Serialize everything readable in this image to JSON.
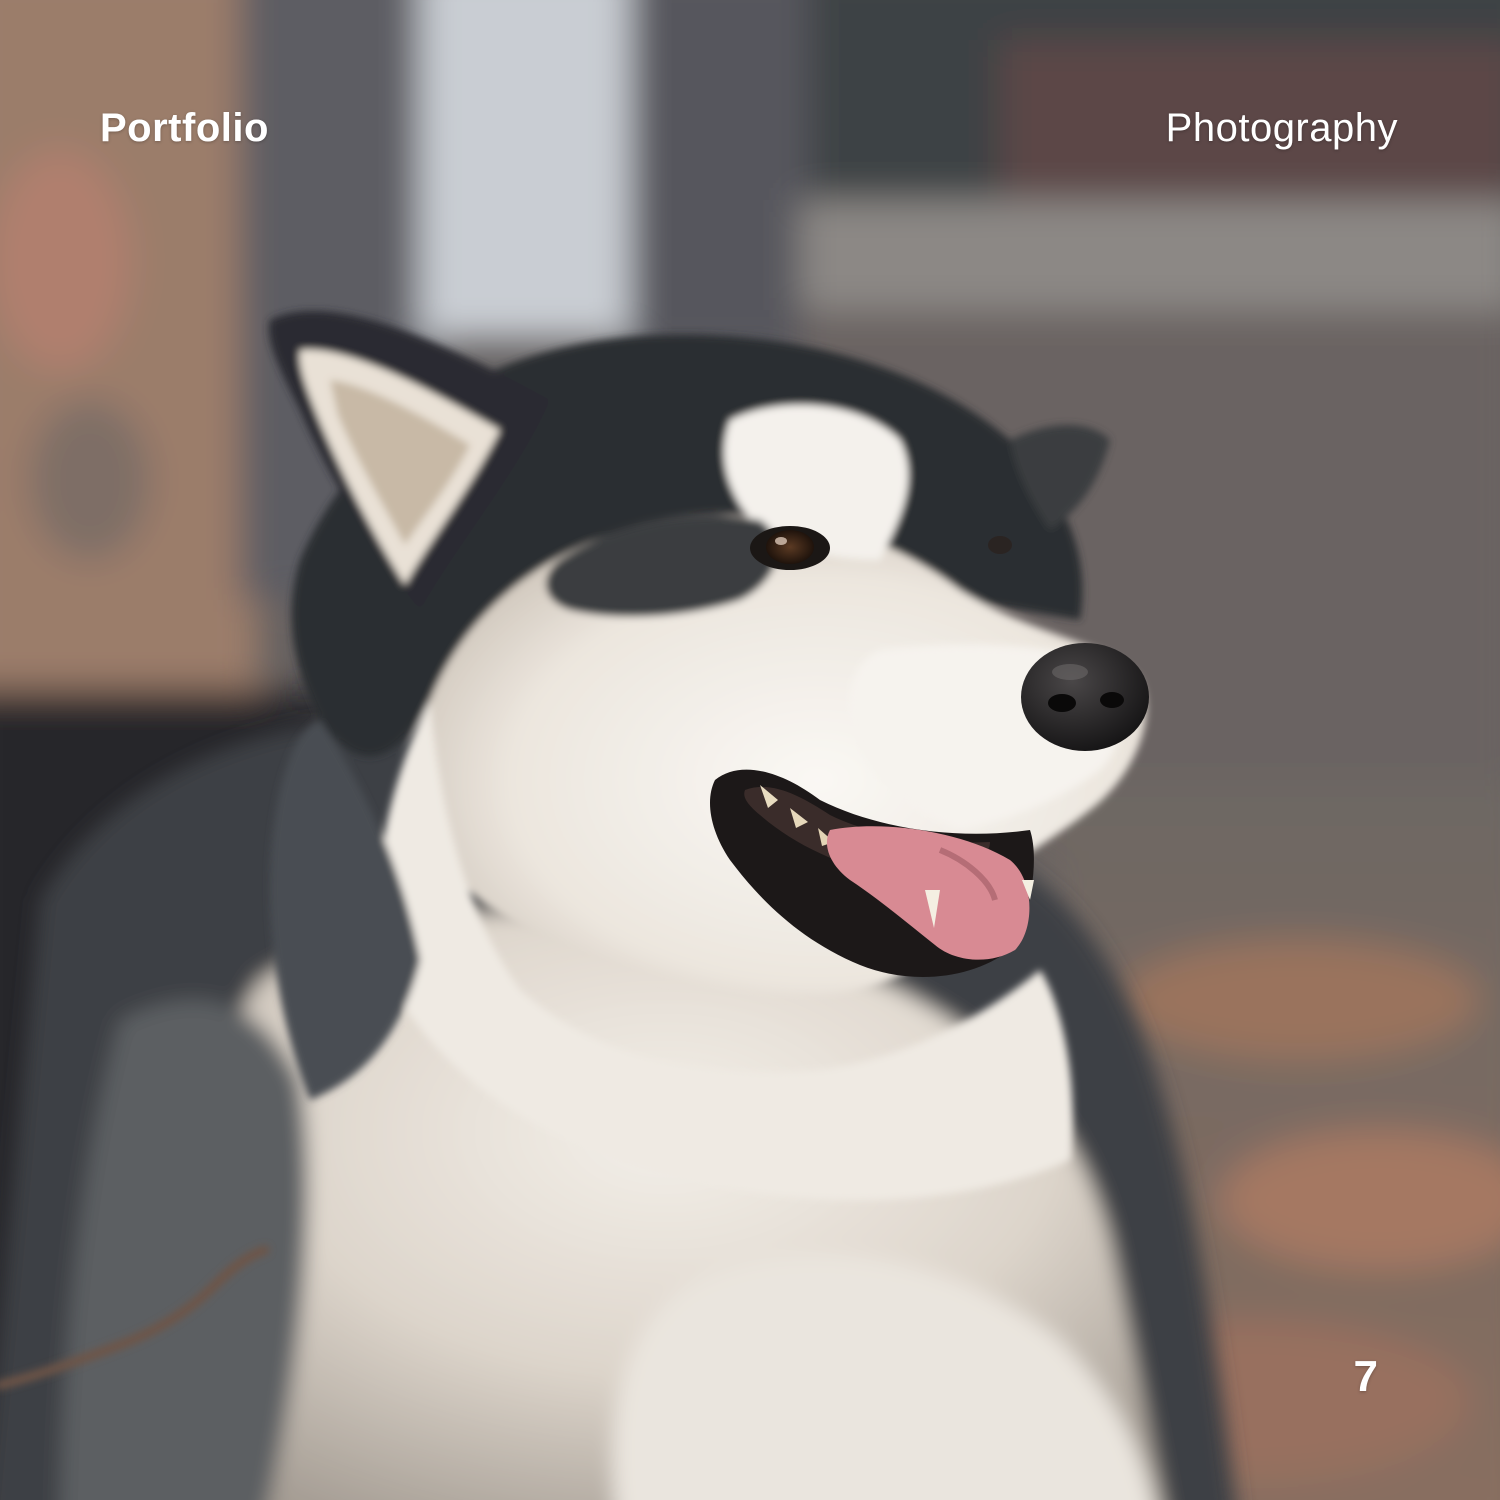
{
  "header": {
    "left_label": "Portfolio",
    "right_label": "Photography"
  },
  "footer": {
    "page_number": "7"
  },
  "photo": {
    "subject": "dog-photo"
  },
  "colors": {
    "text": "#ffffff",
    "fur_dark": "#2e3033",
    "fur_light": "#f2eee8",
    "background_left": "#8a7466",
    "background_right": "#5a5653"
  }
}
